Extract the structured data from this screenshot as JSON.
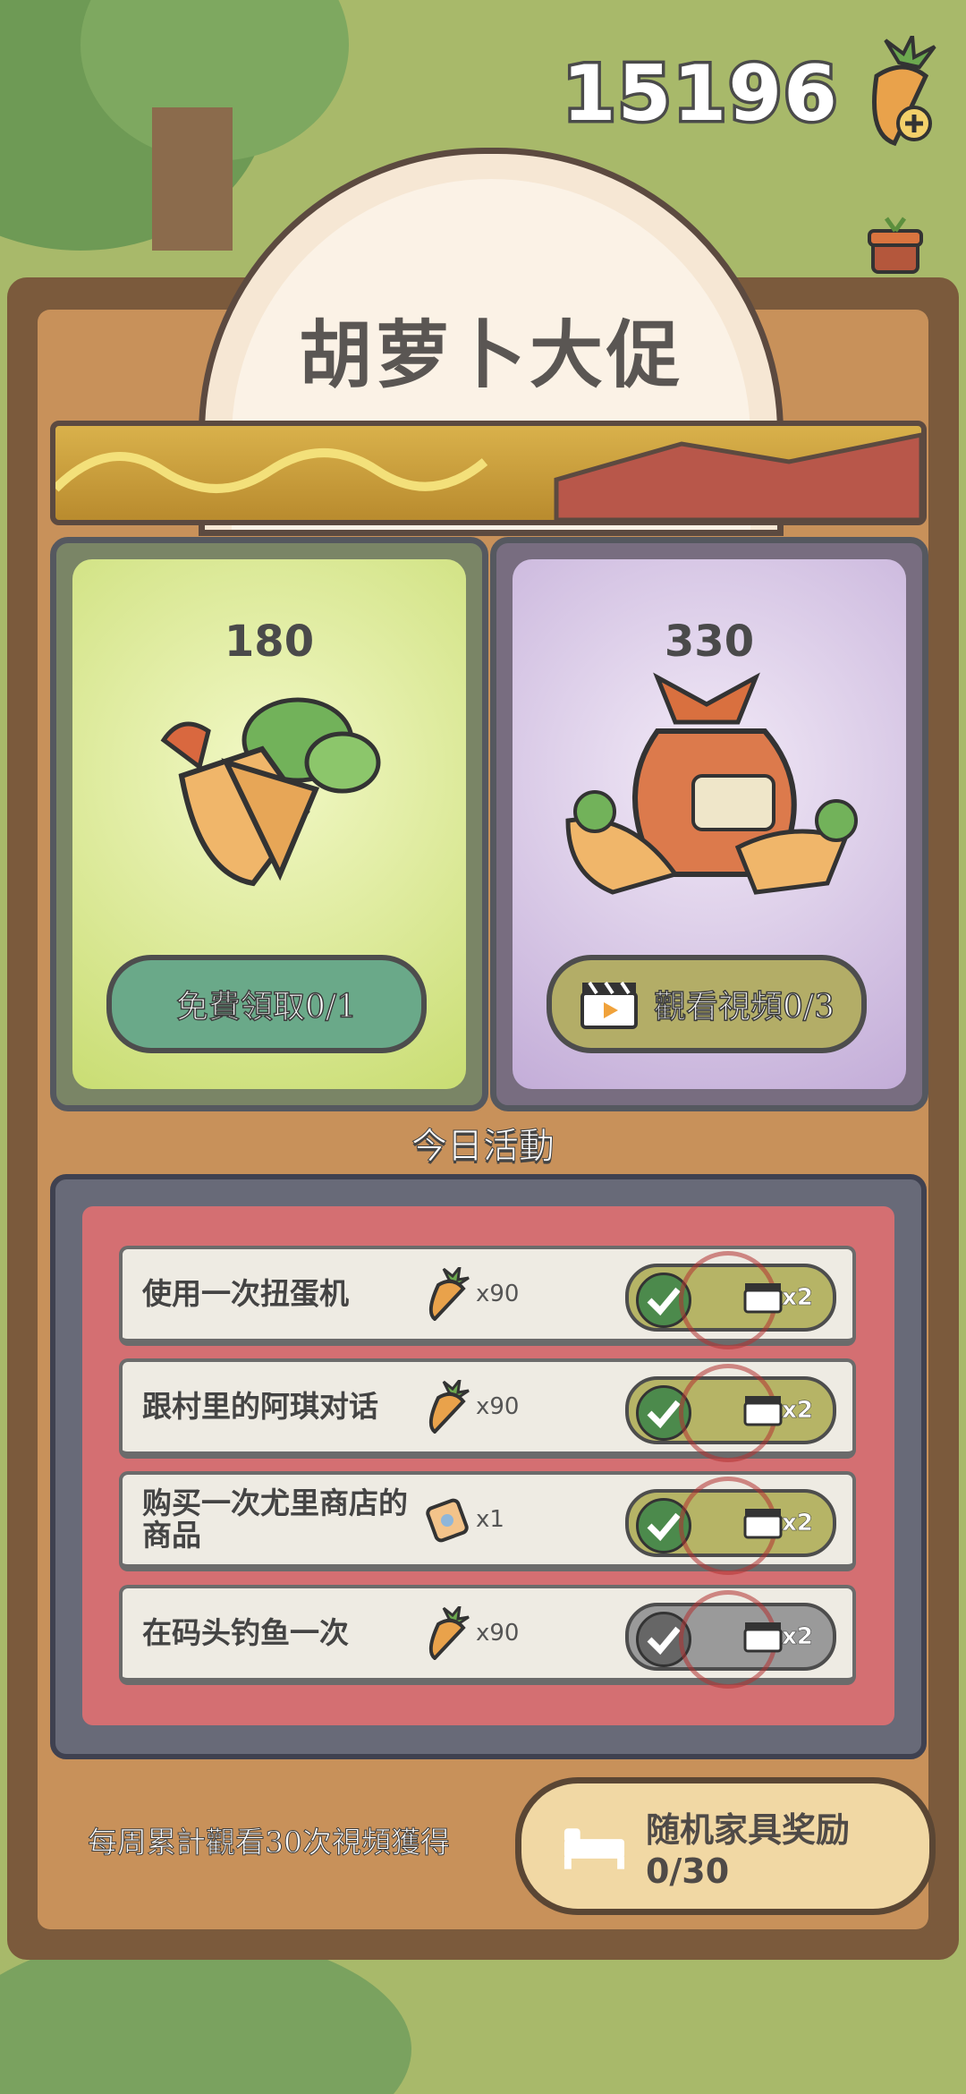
{
  "currency": {
    "amount": "15196",
    "icon": "carrot-plus-icon"
  },
  "title": "胡萝卜大促",
  "offers": [
    {
      "value": "180",
      "button": "免費領取0/1",
      "icon": "carrot-bundle-icon",
      "color": "#cfe27a"
    },
    {
      "value": "330",
      "button": "觀看視頻0/3",
      "icon": "carrot-sack-icon",
      "color": "#c9b8dc"
    }
  ],
  "section_title": "今日活動",
  "tasks": [
    {
      "label": "使用一次扭蛋机",
      "reward_icon": "carrot-icon",
      "qty": "x90",
      "mult": "x2",
      "done": true
    },
    {
      "label": "跟村里的阿琪对话",
      "reward_icon": "carrot-icon",
      "qty": "x90",
      "mult": "x2",
      "done": true
    },
    {
      "label": "购买一次尤里商店的商品",
      "reward_icon": "ticket-icon",
      "qty": "x1",
      "mult": "x2",
      "done": true
    },
    {
      "label": "在码头钓鱼一次",
      "reward_icon": "carrot-icon",
      "qty": "x90",
      "mult": "x2",
      "done": false
    }
  ],
  "weekly": {
    "text": "每周累計觀看30次視頻獲得",
    "button": "随机家具奖励0/30",
    "icon": "bed-icon"
  }
}
